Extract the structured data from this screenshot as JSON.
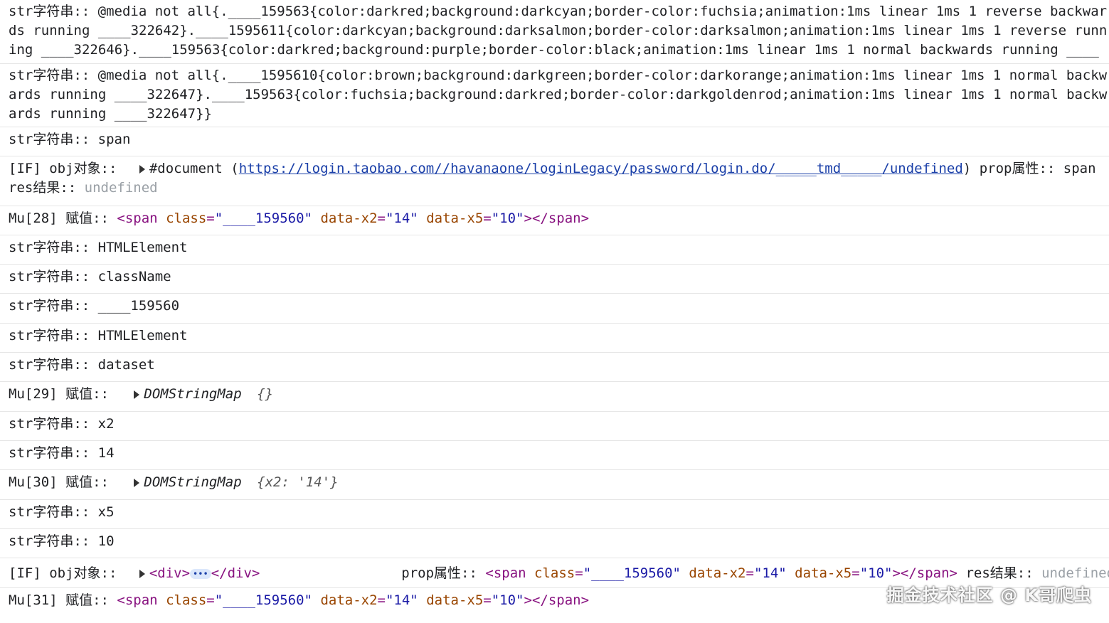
{
  "rows": {
    "r1": "str字符串:: @media not all{.____159563{color:darkred;background:darkcyan;border-color:fuchsia;animation:1ms linear 1ms 1 reverse backwards running ____322642}.____1595611{color:darkcyan;background:darksalmon;border-color:darksalmon;animation:1ms linear 1ms 1 reverse running ____322646}.____159563{color:darkred;background:purple;border-color:black;animation:1ms linear 1ms 1 normal backwards running ____",
    "r2": "str字符串:: @media not all{.____1595610{color:brown;background:darkgreen;border-color:darkorange;animation:1ms linear 1ms 1 normal backwards running ____322647}.____159563{color:fuchsia;background:darkred;border-color:darkgoldenrod;animation:1ms linear 1ms 1 normal backwards running ____322647}}",
    "r3": "str字符串:: span",
    "r4": {
      "prefix": "[IF] obj对象::",
      "doc": "#document",
      "open_paren": "(",
      "url": "https://login.taobao.com//havanaone/loginLegacy/password/login.do/_____tmd_____/undefined",
      "close_paren": ")",
      "prop": "prop属性:: span",
      "res_label": "res结果::",
      "res_value": "undefined"
    },
    "r5": {
      "prefix": "Mu[28] 赋值::",
      "tag_open": "<span",
      "attr1": "class",
      "val1": "\"____159560\"",
      "attr2": "data-x2",
      "val2": "\"14\"",
      "attr3": "data-x5",
      "val3": "\"10\"",
      "tag_close": "></span>"
    },
    "r6": "str字符串:: HTMLElement",
    "r7": "str字符串:: className",
    "r8": "str字符串:: ____159560",
    "r9": "str字符串:: HTMLElement",
    "r10": "str字符串:: dataset",
    "r11": {
      "prefix": "Mu[29] 赋值::",
      "type": "DOMStringMap",
      "obj": "{}"
    },
    "r12": "str字符串:: x2",
    "r13": "str字符串:: 14",
    "r14": {
      "prefix": "Mu[30] 赋值::",
      "type": "DOMStringMap",
      "obj": "{x2: '14'}"
    },
    "r15": "str字符串:: x5",
    "r16": "str字符串:: 10",
    "r17": {
      "prefix": "[IF] obj对象::",
      "div_open": "<div>",
      "ellipsis": "•••",
      "div_close": "</div>",
      "prop_label": "prop属性::",
      "tag_open": "<span",
      "attr1": "class",
      "val1": "\"____159560\"",
      "attr2": "data-x2",
      "val2": "\"14\"",
      "attr3": "data-x5",
      "val3": "\"10\"",
      "tag_close": "></span>",
      "res_label": "res结果::",
      "res_value": "undefined"
    },
    "r18": {
      "prefix": "Mu[31] 赋值::",
      "tag_open": "<span",
      "attr1": "class",
      "val1": "\"____159560\"",
      "attr2": "data-x2",
      "val2": "\"14\"",
      "attr3": "data-x5",
      "val3": "\"10\"",
      "tag_close": "></span>"
    }
  },
  "watermark": "掘金技术社区 @ K哥爬虫"
}
